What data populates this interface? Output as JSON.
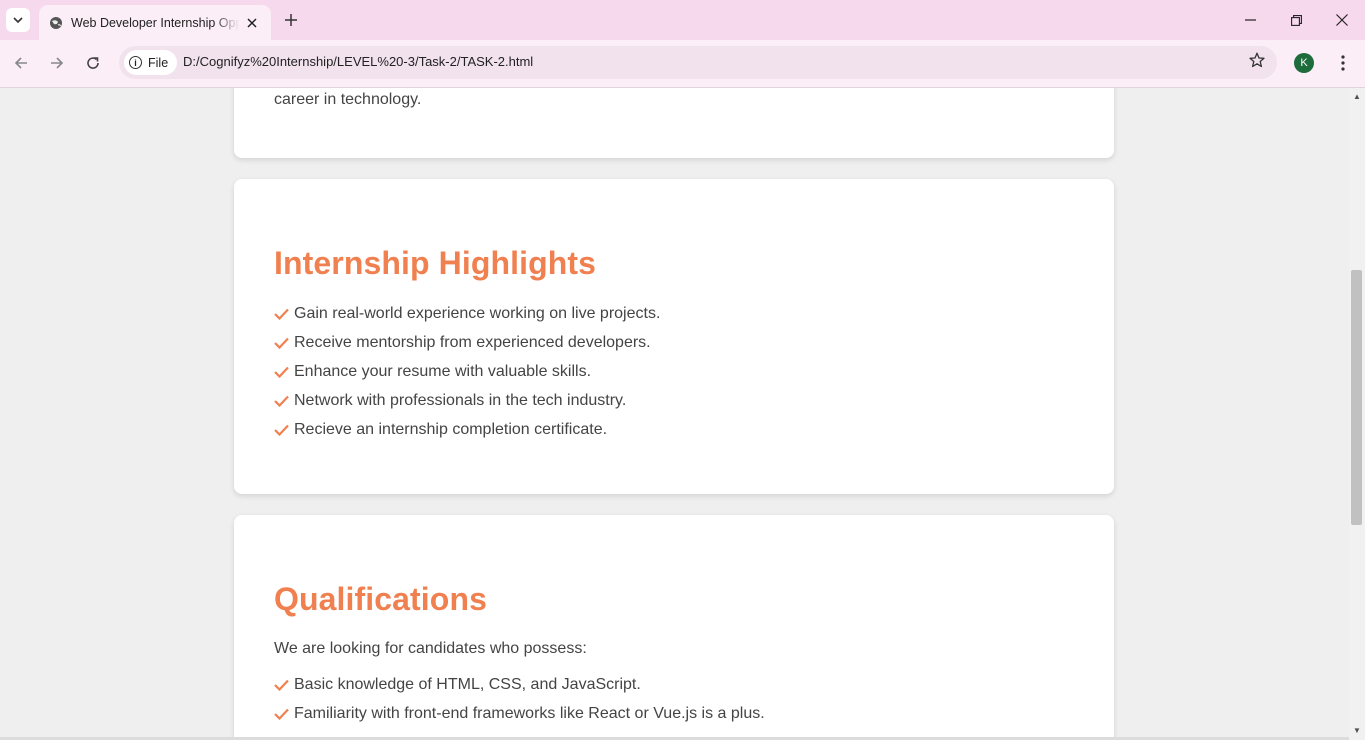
{
  "browser": {
    "tab_title": "Web Developer Internship Opportunity",
    "site_chip_label": "File",
    "url": "D:/Cognifyz%20Internship/LEVEL%20-3/Task-2/TASK-2.html",
    "profile_initial": "K",
    "accent_color": "#f7d9ee",
    "icons": [
      "tab-search-icon",
      "globe-icon",
      "close-icon",
      "plus-icon",
      "minimize-icon",
      "restore-icon",
      "window-close-icon",
      "back-arrow-icon",
      "forward-arrow-icon",
      "reload-icon",
      "info-icon",
      "star-icon",
      "kebab-menu-icon"
    ]
  },
  "page": {
    "top_card": {
      "tail_text": "career in technology."
    },
    "highlights": {
      "title": "Internship Highlights",
      "items": [
        "Gain real-world experience working on live projects.",
        "Receive mentorship from experienced developers.",
        "Enhance your resume with valuable skills.",
        "Network with professionals in the tech industry.",
        "Recieve an internship completion certificate."
      ]
    },
    "qualifications": {
      "title": "Qualifications",
      "intro": "We are looking for candidates who possess:",
      "items": [
        "Basic knowledge of HTML, CSS, and JavaScript.",
        "Familiarity with front-end frameworks like React or Vue.js is a plus."
      ]
    },
    "heading_color": "#f0804f",
    "check_color": "#f0804f"
  },
  "scrollbar": {
    "position_fraction": 0.31
  }
}
